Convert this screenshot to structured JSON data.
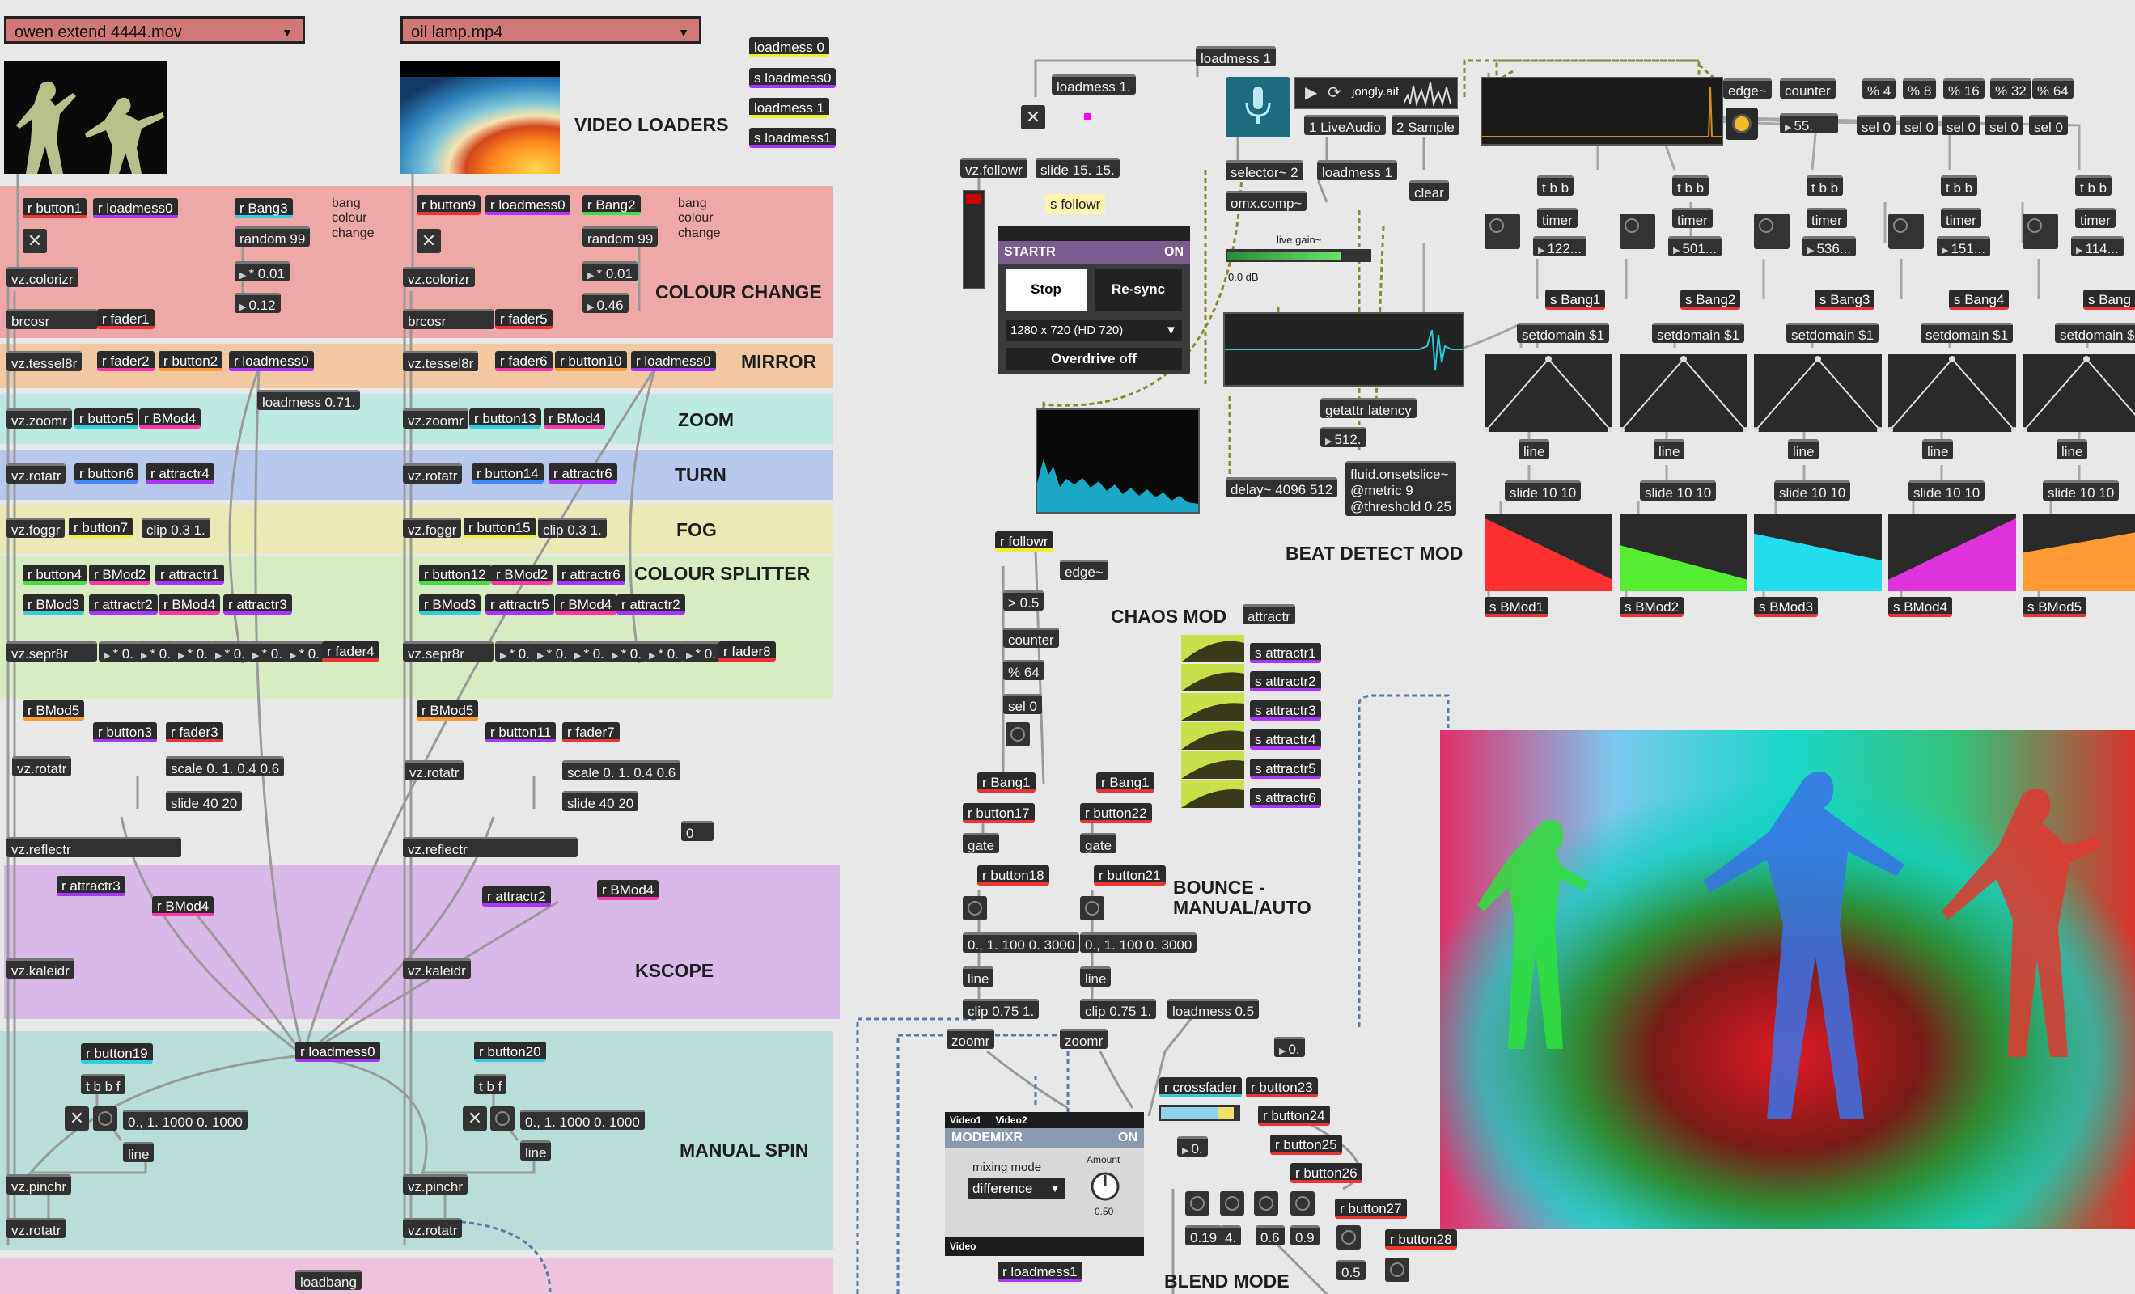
{
  "movie_menus": {
    "left": "owen extend 4444.mov",
    "right": "oil lamp.mp4"
  },
  "sections": {
    "video_loaders": "VIDEO LOADERS",
    "colour_change": "COLOUR CHANGE",
    "mirror": "MIRROR",
    "zoom": "ZOOM",
    "turn": "TURN",
    "fog": "FOG",
    "colour_splitter": "COLOUR SPLITTER",
    "kscope": "KSCOPE",
    "manual_spin": "MANUAL SPIN",
    "beat_detect": "BEAT DETECT MOD",
    "chaos_mod": "CHAOS MOD",
    "bounce_1": "BOUNCE -",
    "bounce_2": "MANUAL/AUTO",
    "blend_mode": "BLEND MODE"
  },
  "comments": {
    "bang_colour_change": "bang\ncolour\nchange"
  },
  "top_loadmess": [
    "loadmess 0",
    "s loadmess0",
    "loadmess 1",
    "s loadmess1"
  ],
  "left_chain": {
    "r_button1": "r button1",
    "r_loadmess0": "r loadmess0",
    "r_bang3": "r Bang3",
    "random99": "random 99",
    "mul001": "* 0.01",
    "val012": "0.12",
    "colorizr": "vz.colorizr",
    "brcosr": "brcosr",
    "r_fader1": "r fader1",
    "tessel8r": "vz.tessel8r",
    "r_fader2": "r fader2",
    "r_button2": "r button2",
    "r_loadmess0b": "r loadmess0",
    "loadmess071": "loadmess 0.71.",
    "zoomr": "vz.zoomr",
    "r_button5": "r button5",
    "r_bmod4": "r BMod4",
    "rotatr": "vz.rotatr",
    "r_button6": "r button6",
    "r_attractr4": "r attractr4",
    "foggr": "vz.foggr",
    "r_button7": "r button7",
    "clip": "clip 0.3 1.",
    "r_button4": "r button4",
    "r_bmod2": "r BMod2",
    "r_attractr1": "r attractr1",
    "r_bmod3": "r BMod3",
    "r_attractr2": "r attractr2",
    "r_bmod4b": "r BMod4",
    "r_attractr3": "r attractr3",
    "seprr": "vz.sepr8r",
    "mul0": "* 0.",
    "r_fader4": "r fader4",
    "r_bmod5": "r BMod5",
    "r_button3": "r button3",
    "r_fader3": "r fader3",
    "rotatr2": "vz.rotatr",
    "scale": "scale 0. 1. 0.4 0.6",
    "slide4020": "slide 40 20",
    "reflectr": "vz.reflectr",
    "r_attractr3b": "r attractr3",
    "r_bmod4c": "r BMod4",
    "kaleidr": "vz.kaleidr",
    "r_button19": "r button19",
    "tbbf": "t b b f",
    "line_msg": "0., 1. 1000 0. 1000",
    "line": "line",
    "pinchr": "vz.pinchr",
    "rotatr3": "vz.rotatr",
    "r_loadmess0c": "r loadmess0",
    "loadbang": "loadbang"
  },
  "right_chain": {
    "r_button9": "r button9",
    "r_loadmess0": "r loadmess0",
    "r_bang2": "r Bang2",
    "random99": "random 99",
    "mul001": "* 0.01",
    "val046": "0.46",
    "colorizr": "vz.colorizr",
    "brcosr": "brcosr",
    "r_fader5": "r fader5",
    "tessel8r": "vz.tessel8r",
    "r_fader6": "r fader6",
    "r_button10": "r button10",
    "r_loadmess0b": "r loadmess0",
    "zoomr": "vz.zoomr",
    "r_button13": "r button13",
    "r_bmod4": "r BMod4",
    "rotatr": "vz.rotatr",
    "r_button14": "r button14",
    "r_attractr6": "r attractr6",
    "foggr": "vz.foggr",
    "r_button15": "r button15",
    "clip": "clip 0.3 1.",
    "r_button12": "r button12",
    "r_bmod2": "r BMod2",
    "r_attractr6b": "r attractr6",
    "r_bmod3": "r BMod3",
    "r_attractr5": "r attractr5",
    "r_bmod4b": "r BMod4",
    "r_attractr2": "r attractr2",
    "seprr": "vz.sepr8r",
    "mul0": "* 0.",
    "r_fader8": "r fader8",
    "r_bmod5": "r BMod5",
    "r_button11": "r button11",
    "r_fader7": "r fader7",
    "rotatr2": "vz.rotatr",
    "scale": "scale 0. 1. 0.4 0.6",
    "slide4020": "slide 40 20",
    "zero": "0",
    "reflectr": "vz.reflectr",
    "r_attractr2b": "r attractr2",
    "r_bmod4c": "r BMod4",
    "kaleidr": "vz.kaleidr",
    "r_button20": "r button20",
    "tbbf": "t b f",
    "line_msg": "0., 1. 1000 0. 1000",
    "line": "line",
    "pinchr": "vz.pinchr",
    "rotatr3": "vz.rotatr"
  },
  "middle": {
    "loadmess1a": "loadmess 1",
    "loadmess1b": "loadmess 1.",
    "followr": "vz.followr",
    "slide1515": "slide 15. 15.",
    "s_followr": "s followr",
    "jongly": "jongly.aif",
    "live_audio": "1 LiveAudio",
    "sample": "2 Sample",
    "selector": "selector~ 2",
    "loadmess1c": "loadmess 1",
    "omx": "omx.comp~",
    "clear": "clear",
    "live_gain": "live.gain~",
    "db": "0.0 dB",
    "startr_title": "STARTR",
    "startr_on": "ON",
    "stop": "Stop",
    "resync": "Re-sync",
    "resolution": "1280 x 720 (HD 720)",
    "overdrive": "Overdrive off",
    "getattr": "getattr latency",
    "latency": "512.",
    "delay": "delay~ 4096 512",
    "onset": "fluid.onsetslice~\n@metric 9\n@threshold 0.25",
    "r_followr": "r followr",
    "edge": "edge~",
    "gt05": "> 0.5",
    "counter": "counter",
    "mod64": "% 64",
    "sel0": "sel 0",
    "attractr": "attractr",
    "s_attractr": [
      "s attractr1",
      "s attractr2",
      "s attractr3",
      "s attractr4",
      "s attractr5",
      "s attractr6"
    ],
    "r_bang1a": "r Bang1",
    "r_button17": "r button17",
    "gate": "gate",
    "r_button18": "r button18",
    "line_msg": "0., 1. 100 0. 3000",
    "line": "line",
    "clip": "clip 0.75 1.",
    "zoomr": "zoomr",
    "r_bang1b": "r Bang1",
    "r_button22": "r button22",
    "r_button21": "r button21",
    "loadmess05": "loadmess 0.5",
    "r_crossfader": "r crossfader",
    "r_button23": "r button23",
    "r_button24": "r button24",
    "r_button25": "r button25",
    "r_button26": "r button26",
    "r_button27": "r button27",
    "r_button28": "r button28",
    "zero_a": "0.",
    "zero_b": "0.",
    "r_loadmess1": "r loadmess1",
    "v019": "0.19",
    "v4": "4.",
    "v06": "0.6",
    "v09": "0.9",
    "v05": "0.5",
    "video1": "Video1",
    "video2": "Video2",
    "modemixr": "MODEMIXR",
    "modemixr_on": "ON",
    "mixing_mode_label": "mixing mode",
    "mixing_mode": "difference",
    "amount_label": "Amount",
    "amount": "0.50",
    "video_out": "Video"
  },
  "beat": {
    "edge": "edge~",
    "counter": "counter",
    "mods": [
      "% 4",
      "% 8",
      "% 16",
      "% 32",
      "% 64"
    ],
    "sels": [
      "sel 0",
      "sel 0",
      "sel 0",
      "sel 0",
      "sel 0"
    ],
    "count": "55.",
    "tbb": "t b b",
    "timer": "timer",
    "times": [
      "122...",
      "501...",
      "536...",
      "151...",
      "114..."
    ],
    "s_bangs": [
      "s Bang1",
      "s Bang2",
      "s Bang3",
      "s Bang4",
      "s Bang"
    ],
    "setdomain": "setdomain $1",
    "line": "line",
    "slide": "slide 10 10",
    "s_bmods": [
      "s BMod1",
      "s BMod2",
      "s BMod3",
      "s BMod4",
      "s BMod5"
    ],
    "colors": [
      "#ff3030",
      "#55ee33",
      "#22ddee",
      "#dd33dd",
      "#ff9933"
    ]
  }
}
